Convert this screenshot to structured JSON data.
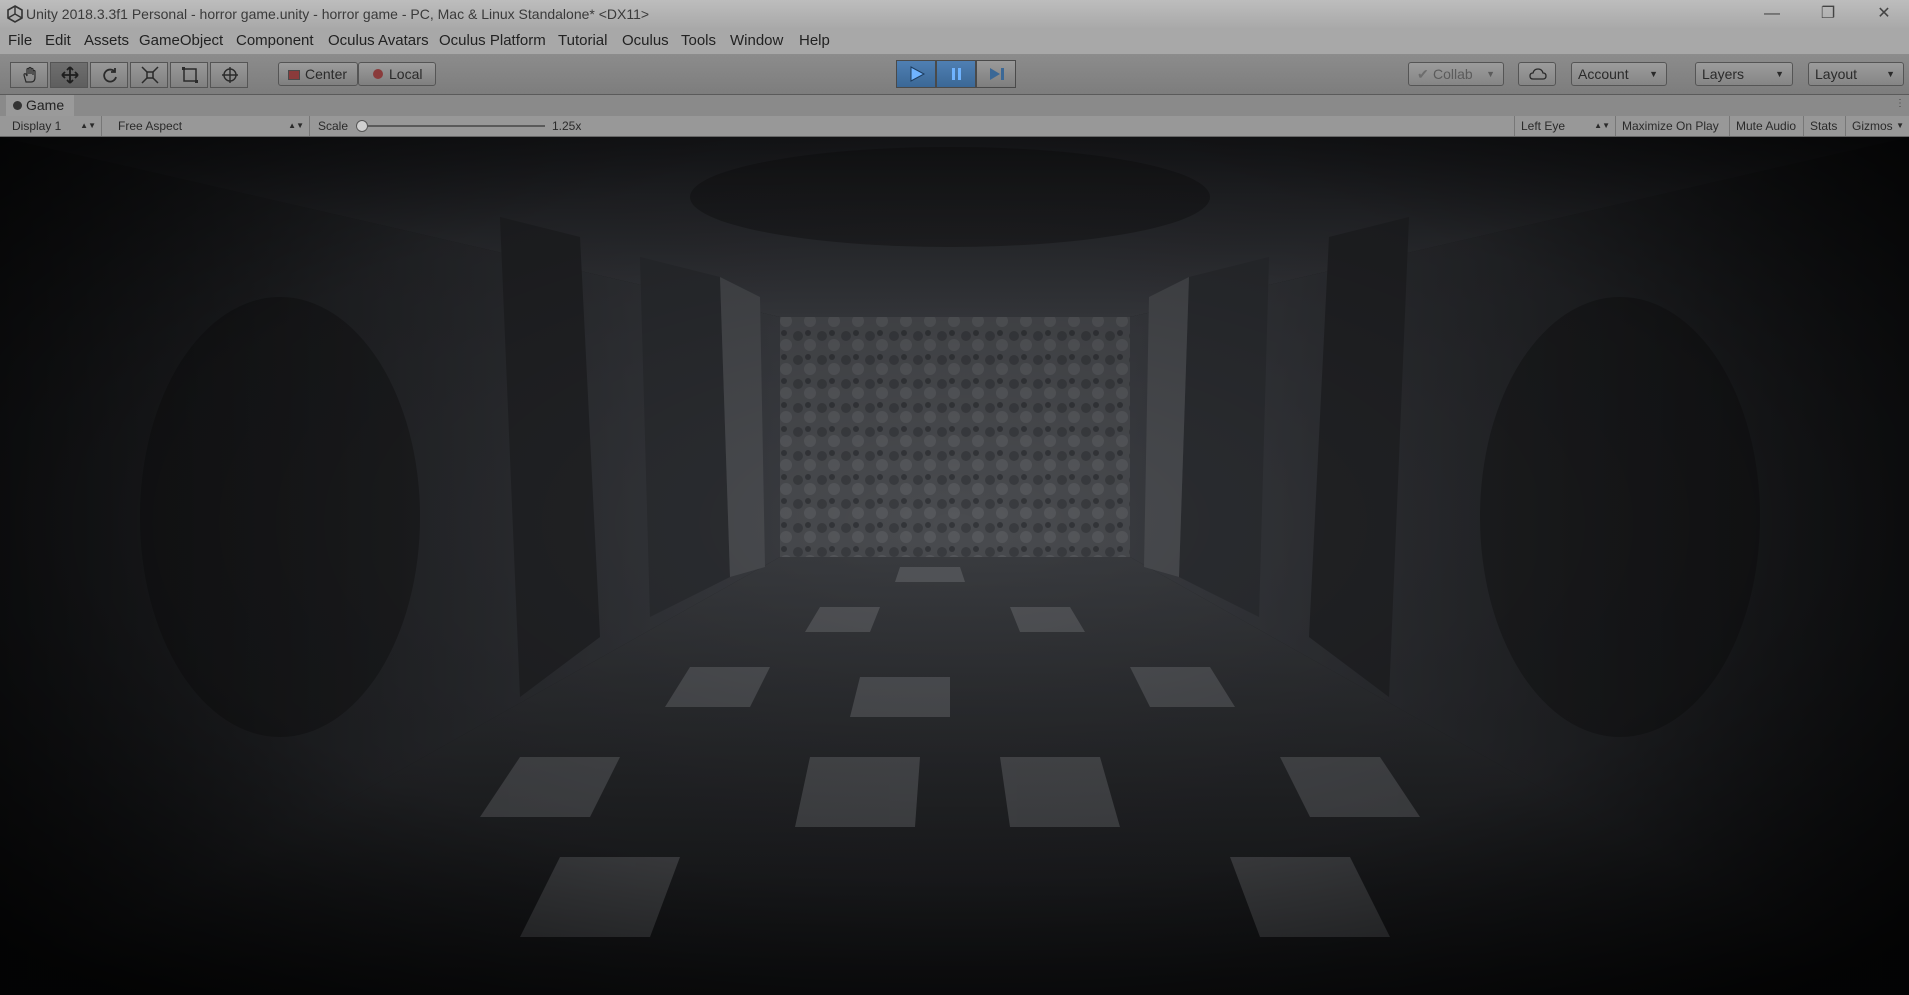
{
  "window": {
    "title": "Unity 2018.3.3f1 Personal - horror game.unity - horror game - PC, Mac & Linux Standalone* <DX11>",
    "controls": [
      "minimize",
      "restore",
      "close"
    ]
  },
  "menu": {
    "items": [
      "File",
      "Edit",
      "Assets",
      "GameObject",
      "Component",
      "Oculus Avatars",
      "Oculus Platform",
      "Tutorial",
      "Oculus",
      "Tools",
      "Window",
      "Help"
    ]
  },
  "toolbar": {
    "tools": [
      "hand-tool",
      "move-tool",
      "rotate-tool",
      "scale-tool",
      "rect-tool",
      "transform-tool"
    ],
    "pivot_label": "Center",
    "space_label": "Local",
    "play_state": "playing",
    "collab_label": "Collab",
    "account_label": "Account",
    "layers_label": "Layers",
    "layout_label": "Layout",
    "accent_color": "#3b6896"
  },
  "game_view": {
    "tab_label": "Game",
    "display": "Display 1",
    "aspect": "Free Aspect",
    "scale_label": "Scale",
    "scale_value": "1.25x",
    "eye": "Left Eye",
    "maximize_on_play": "Maximize On Play",
    "mute_audio": "Mute Audio",
    "stats": "Stats",
    "gizmos": "Gizmos"
  }
}
